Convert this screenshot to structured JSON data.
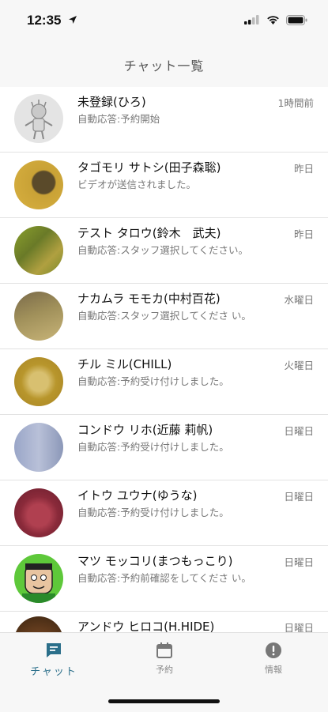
{
  "status_bar": {
    "time": "12:35"
  },
  "nav": {
    "title": "チャット一覧"
  },
  "chats": [
    {
      "name": "未登録(ひろ)",
      "message": "自動応答:予約開始",
      "time": "1時間前"
    },
    {
      "name": "タゴモリ サトシ(田子森聡)",
      "message": "ビデオが送信されました。",
      "time": "昨日"
    },
    {
      "name": "テスト タロウ(鈴木　武夫)",
      "message": "自動応答:スタッフ選択してください。",
      "time": "昨日"
    },
    {
      "name": "ナカムラ モモカ(中村百花)",
      "message": "自動応答:スタッフ選択してくださ い。",
      "time": "水曜日"
    },
    {
      "name": "チル ミル(CHILL)",
      "message": "自動応答:予約受け付けしました。",
      "time": "火曜日"
    },
    {
      "name": "コンドウ リホ(近藤 莉帆)",
      "message": "自動応答:予約受け付けしました。",
      "time": "日曜日"
    },
    {
      "name": "イトウ ユウナ(ゆうな)",
      "message": "自動応答:予約受け付けしました。",
      "time": "日曜日"
    },
    {
      "name": "マツ モッコリ(まつもっこり)",
      "message": "自動応答:予約前確認をしてくださ い。",
      "time": "日曜日"
    },
    {
      "name": "アンドウ ヒロコ(H.HIDE)",
      "message": "",
      "time": "日曜日"
    }
  ],
  "tabs": [
    {
      "label": "チャット",
      "icon": "chat-bubble-icon",
      "active": true
    },
    {
      "label": "予約",
      "icon": "calendar-icon",
      "active": false
    },
    {
      "label": "情報",
      "icon": "info-alert-icon",
      "active": false
    }
  ],
  "colors": {
    "accent": "#2b6f8a",
    "text_secondary": "#777777"
  }
}
